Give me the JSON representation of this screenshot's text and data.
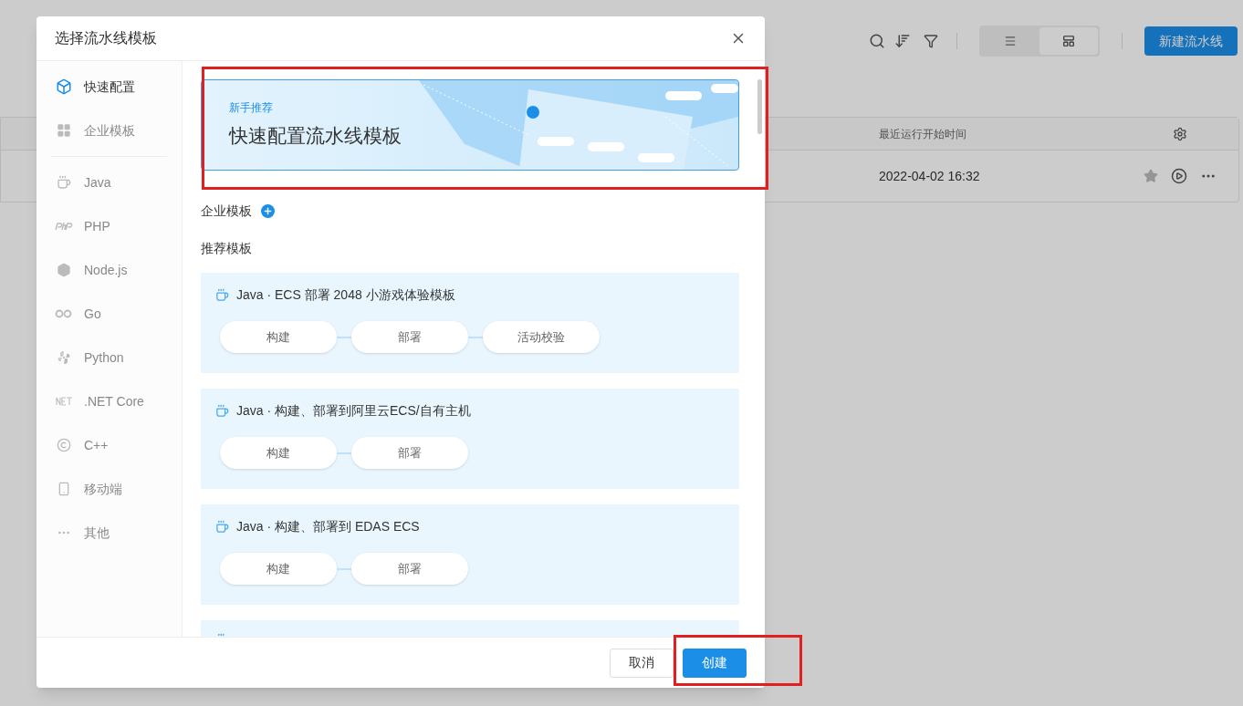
{
  "page": {
    "toolbar": {
      "view_modes": [
        {
          "selected": false
        },
        {
          "selected": true
        }
      ],
      "new_button": "新建流水线"
    },
    "table": {
      "columns": [
        "最近运行开始时间"
      ],
      "rows": [
        {
          "cells": [
            "2022-04-02 16:32"
          ],
          "starred": false
        }
      ]
    }
  },
  "dialog": {
    "title": "选择流水线模板",
    "sidebar": {
      "groups": [
        [
          {
            "label": "快速配置",
            "selected": true
          },
          {
            "label": "企业模板",
            "selected": false
          }
        ],
        [
          {
            "label": "Java",
            "selected": false
          },
          {
            "label": "PHP",
            "selected": false
          },
          {
            "label": "Node.js",
            "selected": false
          },
          {
            "label": "Go",
            "selected": false
          },
          {
            "label": "Python",
            "selected": false
          },
          {
            "label": ".NET Core",
            "selected": false
          },
          {
            "label": "C++",
            "selected": false
          },
          {
            "label": "移动端",
            "selected": false
          },
          {
            "label": "其他",
            "selected": false
          }
        ]
      ]
    },
    "banner": {
      "tag": "新手推荐",
      "title": "快速配置流水线模板"
    },
    "enterprise_section": "企业模板",
    "recommended_section": "推荐模板",
    "templates": [
      {
        "title": "Java · ECS 部署 2048 小游戏体验模板",
        "stages": [
          "构建",
          "部署",
          "活动校验"
        ]
      },
      {
        "title": "Java · 构建、部署到阿里云ECS/自有主机",
        "stages": [
          "构建",
          "部署"
        ]
      },
      {
        "title": "Java · 构建、部署到 EDAS ECS",
        "stages": [
          "构建",
          "部署"
        ]
      },
      {
        "partial": true
      }
    ],
    "buttons": [
      {
        "label": "取消",
        "kind": "secondary"
      },
      {
        "label": "创建",
        "kind": "primary"
      }
    ]
  }
}
